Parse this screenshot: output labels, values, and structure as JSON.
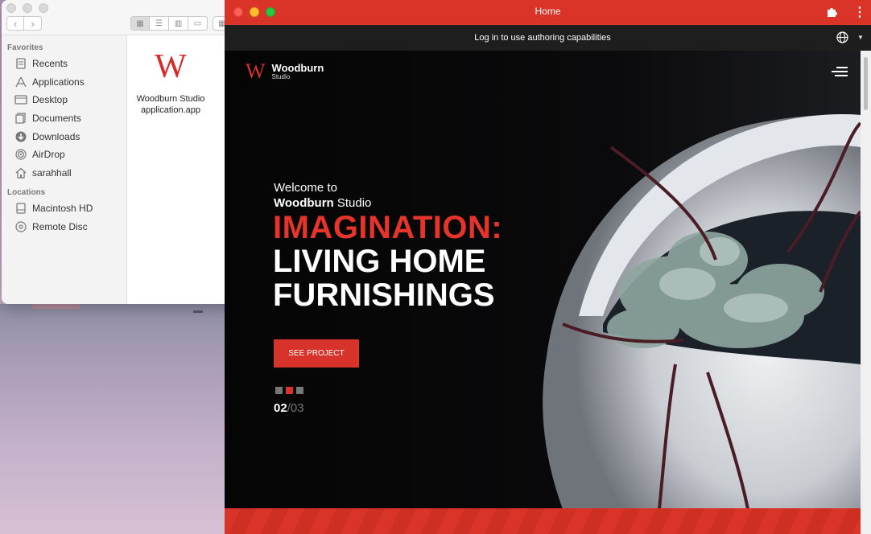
{
  "finder": {
    "sidebar": {
      "favorites_title": "Favorites",
      "favorites": [
        {
          "label": "Recents",
          "icon": "recents-icon"
        },
        {
          "label": "Applications",
          "icon": "applications-icon"
        },
        {
          "label": "Desktop",
          "icon": "desktop-icon"
        },
        {
          "label": "Documents",
          "icon": "documents-icon"
        },
        {
          "label": "Downloads",
          "icon": "downloads-icon"
        },
        {
          "label": "AirDrop",
          "icon": "airdrop-icon"
        },
        {
          "label": "sarahhall",
          "icon": "home-icon"
        }
      ],
      "locations_title": "Locations",
      "locations": [
        {
          "label": "Macintosh HD",
          "icon": "disk-icon"
        },
        {
          "label": "Remote Disc",
          "icon": "remote-disc-icon"
        }
      ]
    },
    "file": {
      "icon_letter": "W",
      "name_line1": "Woodburn Studio",
      "name_line2": "application.app"
    }
  },
  "app": {
    "title": "Home",
    "subbar_text": "Log in to use authoring capabilities",
    "logo": {
      "letter": "W",
      "name": "Woodburn",
      "sub": "Studio"
    },
    "hero": {
      "welcome": "Welcome to",
      "studio_bold": "Woodburn",
      "studio_rest": " Studio",
      "line1": "IMAGINATION:",
      "line2": "LIVING HOME",
      "line3": "FURNISHINGS",
      "cta": "SEE PROJECT",
      "current_slide": "02",
      "separator": "/",
      "total_slides": "03",
      "active_dot": 2
    }
  },
  "colors": {
    "brand_red": "#d7332a",
    "titlebar_red": "#d93427"
  }
}
